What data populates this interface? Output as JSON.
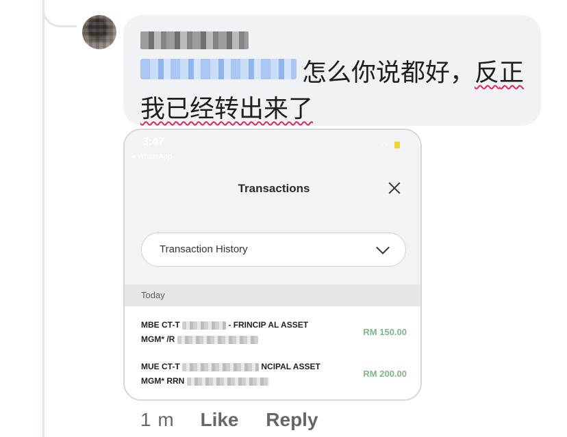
{
  "comment": {
    "text_main": "怎么你说都好，",
    "text_underlined_1": "反",
    "text_underlined_2": "正我已经转出来了"
  },
  "screenshot": {
    "status_time": "3:47",
    "status_back": "◂ WhatsApp",
    "title": "Transactions",
    "dropdown_value": "Transaction History",
    "section_label": "Today",
    "transactions": [
      {
        "line1_a": "MBE CT-T",
        "line1_b": "- FRINCIP",
        "line1_c": "AL ASSET",
        "line2_a": "MGM*",
        "line2_b": "/R",
        "amount": "RM 150.00"
      },
      {
        "line1_a": "MUE CT-T",
        "line1_b": "",
        "line1_c": "NCIPAL ASSET",
        "line2_a": "MGM*",
        "line2_b": "RRN",
        "amount": "RM 200.00"
      }
    ],
    "colors": {
      "amount": "#7fb58a",
      "accent_underline": "#e0245e"
    }
  },
  "actions": {
    "time_ago": "1 m",
    "like_label": "Like",
    "reply_label": "Reply"
  }
}
